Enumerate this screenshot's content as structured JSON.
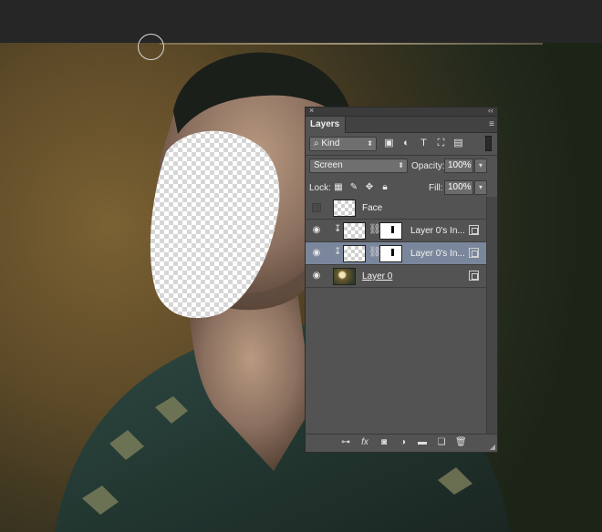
{
  "panel": {
    "close_glyph": "×",
    "collapse_glyph": "‹‹",
    "tab_label": "Layers",
    "menu_glyph": "≡",
    "filter": {
      "kind_label": "Kind",
      "icons": [
        "image-filter-icon",
        "adjustment-filter-icon",
        "type-filter-icon",
        "shape-filter-icon",
        "smart-object-filter-icon"
      ]
    },
    "blend_mode": "Screen",
    "opacity_label": "Opacity:",
    "opacity_value": "100%",
    "lock_label": "Lock:",
    "fill_label": "Fill:",
    "fill_value": "100%",
    "layers": [
      {
        "name": "Face",
        "visible": false,
        "selected": false
      },
      {
        "name": "Layer 0's In...",
        "visible": true,
        "selected": false
      },
      {
        "name": "Layer 0's In...",
        "visible": true,
        "selected": true
      },
      {
        "name": "Layer 0",
        "visible": true,
        "selected": false
      }
    ],
    "footer_icons": [
      "link-layers-icon",
      "fx-icon",
      "add-mask-icon",
      "adjustment-layer-icon",
      "new-group-icon",
      "new-layer-icon",
      "delete-layer-icon"
    ]
  }
}
